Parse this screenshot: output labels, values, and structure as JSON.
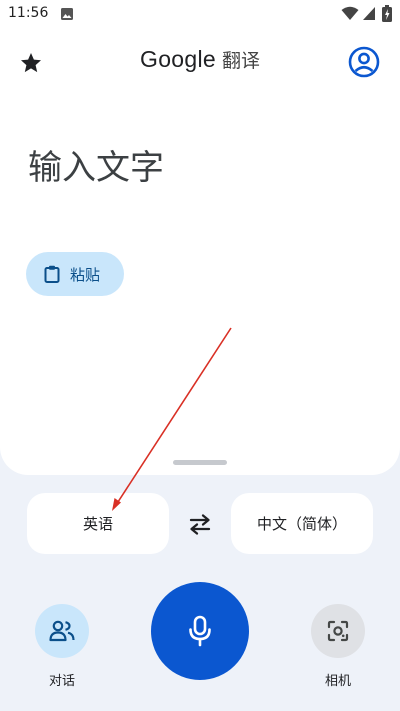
{
  "status_bar": {
    "time": "11:56"
  },
  "header": {
    "logo_text": "Google",
    "app_name": "翻译"
  },
  "input": {
    "placeholder": "输入文字"
  },
  "paste_button": {
    "label": "粘贴"
  },
  "languages": {
    "source": "英语",
    "target": "中文（简体）"
  },
  "bottom_bar": {
    "conversation_label": "对话",
    "camera_label": "相机"
  },
  "colors": {
    "accent": "#0b57d0",
    "mic_button": "#0b57d0",
    "paste_bg": "#c9e6fb",
    "annotation_arrow": "#d93025"
  }
}
